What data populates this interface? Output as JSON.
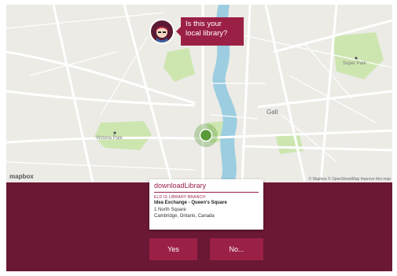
{
  "prompt": {
    "line1": "Is this your",
    "line2": "local library?"
  },
  "map": {
    "labels": {
      "galt": "Galt",
      "victoria_park": "Victoria Park",
      "soper_park": "Soper Park"
    },
    "mapbox_logo": "mapbox",
    "attribution": "© Mapbox © OpenStreetMap Improve this map"
  },
  "library_card": {
    "app_name": "downloadLibrary",
    "branch_heading": "ELD IS LIBRARY BRANCH",
    "branch_name": "Idea Exchange - Queen's Square",
    "address_line1": "1 North Square",
    "address_line2": "Cambridge, Ontario, Canada"
  },
  "buttons": {
    "yes": "Yes",
    "no": "No..."
  },
  "colors": {
    "brand": "#9b2046",
    "panel": "#6a1834",
    "river": "#9ccde0",
    "park": "#cde6b0",
    "marker": "#5a9a38"
  }
}
